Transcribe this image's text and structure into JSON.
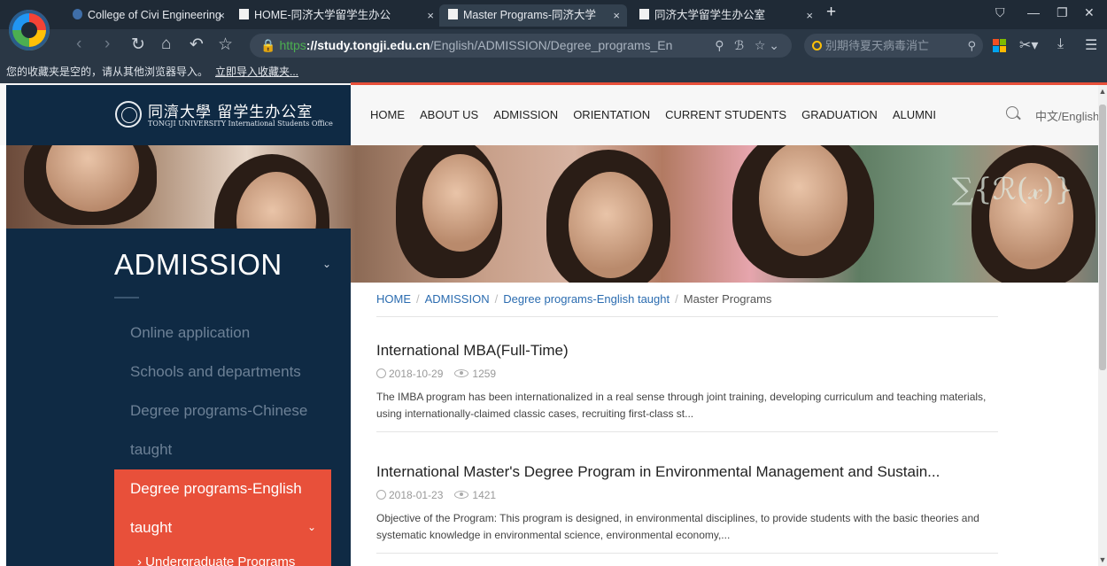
{
  "browser": {
    "tabs": [
      {
        "label": "College of Civi Engineering",
        "close": "×"
      },
      {
        "label": "HOME-同济大学留学生办公",
        "close": "×"
      },
      {
        "label": "Master Programs-同济大学",
        "close": "×"
      },
      {
        "label": "同济大学留学生办公室",
        "close": "×"
      }
    ],
    "new_tab": "+",
    "window_controls": {
      "skin": "⛉",
      "minimize": "—",
      "restore": "❐",
      "close": "✕"
    },
    "url": {
      "scheme": "https",
      "host": "://study.tongji.edu.cn",
      "path": "/English/ADMISSION/Degree_programs_En"
    },
    "search_placeholder": "别期待夏天病毒消亡",
    "bookmark_empty": "您的收藏夹是空的，请从其他浏览器导入。",
    "bookmark_import_link": "立即导入收藏夹..."
  },
  "site": {
    "logo": {
      "cn": "同濟大學 留学生办公室",
      "en": "TONGJI UNIVERSITY   International Students Office"
    },
    "nav": [
      "HOME",
      "ABOUT US",
      "ADMISSION",
      "ORIENTATION",
      "CURRENT STUDENTS",
      "GRADUATION",
      "ALUMNI"
    ],
    "lang": "中文/English",
    "sidebar": {
      "title": "ADMISSION",
      "items": [
        "Online application",
        "Schools and departments",
        "Degree programs-Chinese",
        "taught"
      ],
      "active_line1": "Degree programs-English",
      "active_line2": "taught",
      "sub_item": "› Undergraduate Programs"
    },
    "breadcrumb": [
      "HOME",
      "ADMISSION",
      "Degree programs-English taught",
      "Master Programs"
    ],
    "articles": [
      {
        "title": "International MBA(Full-Time)",
        "date": "2018-10-29",
        "views": "1259",
        "summary": "The IMBA program has been internationalized in a real sense through joint training, developing curriculum and teaching materials, using internationally-claimed classic cases, recruiting first-class st..."
      },
      {
        "title": "International Master's Degree Program in Environmental Management and Sustain...",
        "date": "2018-01-23",
        "views": "1421",
        "summary": "Objective of the Program: This program is designed, in environmental disciplines, to provide students with the basic theories and systematic knowledge in environmental science, environmental economy,..."
      }
    ]
  }
}
